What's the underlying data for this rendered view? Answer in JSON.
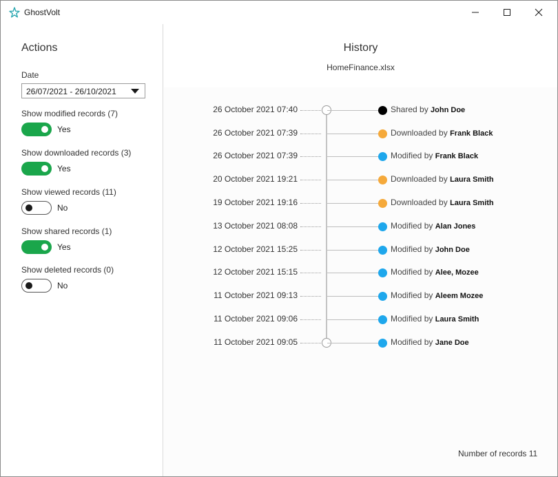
{
  "app": {
    "title": "GhostVolt",
    "accent": "#2aa7b0"
  },
  "sidebar": {
    "title": "Actions",
    "date_label": "Date",
    "date_value": "26/07/2021 - 26/10/2021",
    "toggles": [
      {
        "label": "Show modified records (7)",
        "state": "Yes",
        "on": true
      },
      {
        "label": "Show downloaded records (3)",
        "state": "Yes",
        "on": true
      },
      {
        "label": "Show viewed records (11)",
        "state": "No",
        "on": false
      },
      {
        "label": "Show shared records (1)",
        "state": "Yes",
        "on": true
      },
      {
        "label": "Show deleted records (0)",
        "state": "No",
        "on": false
      }
    ]
  },
  "main": {
    "title": "History",
    "filename": "HomeFinance.xlsx",
    "events": [
      {
        "time": "26 October 2021 07:40",
        "action": "Shared by",
        "user": "John Doe",
        "color": "#000000"
      },
      {
        "time": "26 October 2021 07:39",
        "action": "Downloaded by",
        "user": "Frank Black",
        "color": "#f5a93a"
      },
      {
        "time": "26 October 2021 07:39",
        "action": "Modified by",
        "user": "Frank Black",
        "color": "#1ea7ec"
      },
      {
        "time": "20 October 2021 19:21",
        "action": "Downloaded by",
        "user": "Laura Smith",
        "color": "#f5a93a"
      },
      {
        "time": "19 October 2021 19:16",
        "action": "Downloaded by",
        "user": "Laura Smith",
        "color": "#f5a93a"
      },
      {
        "time": "13 October 2021 08:08",
        "action": "Modified by",
        "user": "Alan Jones",
        "color": "#1ea7ec"
      },
      {
        "time": "12 October 2021 15:25",
        "action": "Modified by",
        "user": "John Doe",
        "color": "#1ea7ec"
      },
      {
        "time": "12 October 2021 15:15",
        "action": "Modified by",
        "user": "Alee, Mozee",
        "color": "#1ea7ec"
      },
      {
        "time": "11 October 2021 09:13",
        "action": "Modified by",
        "user": "Aleem Mozee",
        "color": "#1ea7ec"
      },
      {
        "time": "11 October 2021 09:06",
        "action": "Modified by",
        "user": "Laura Smith",
        "color": "#1ea7ec"
      },
      {
        "time": "11 October 2021 09:05",
        "action": "Modified by",
        "user": "Jane Doe",
        "color": "#1ea7ec"
      }
    ],
    "records_count": "Number of records 11"
  }
}
